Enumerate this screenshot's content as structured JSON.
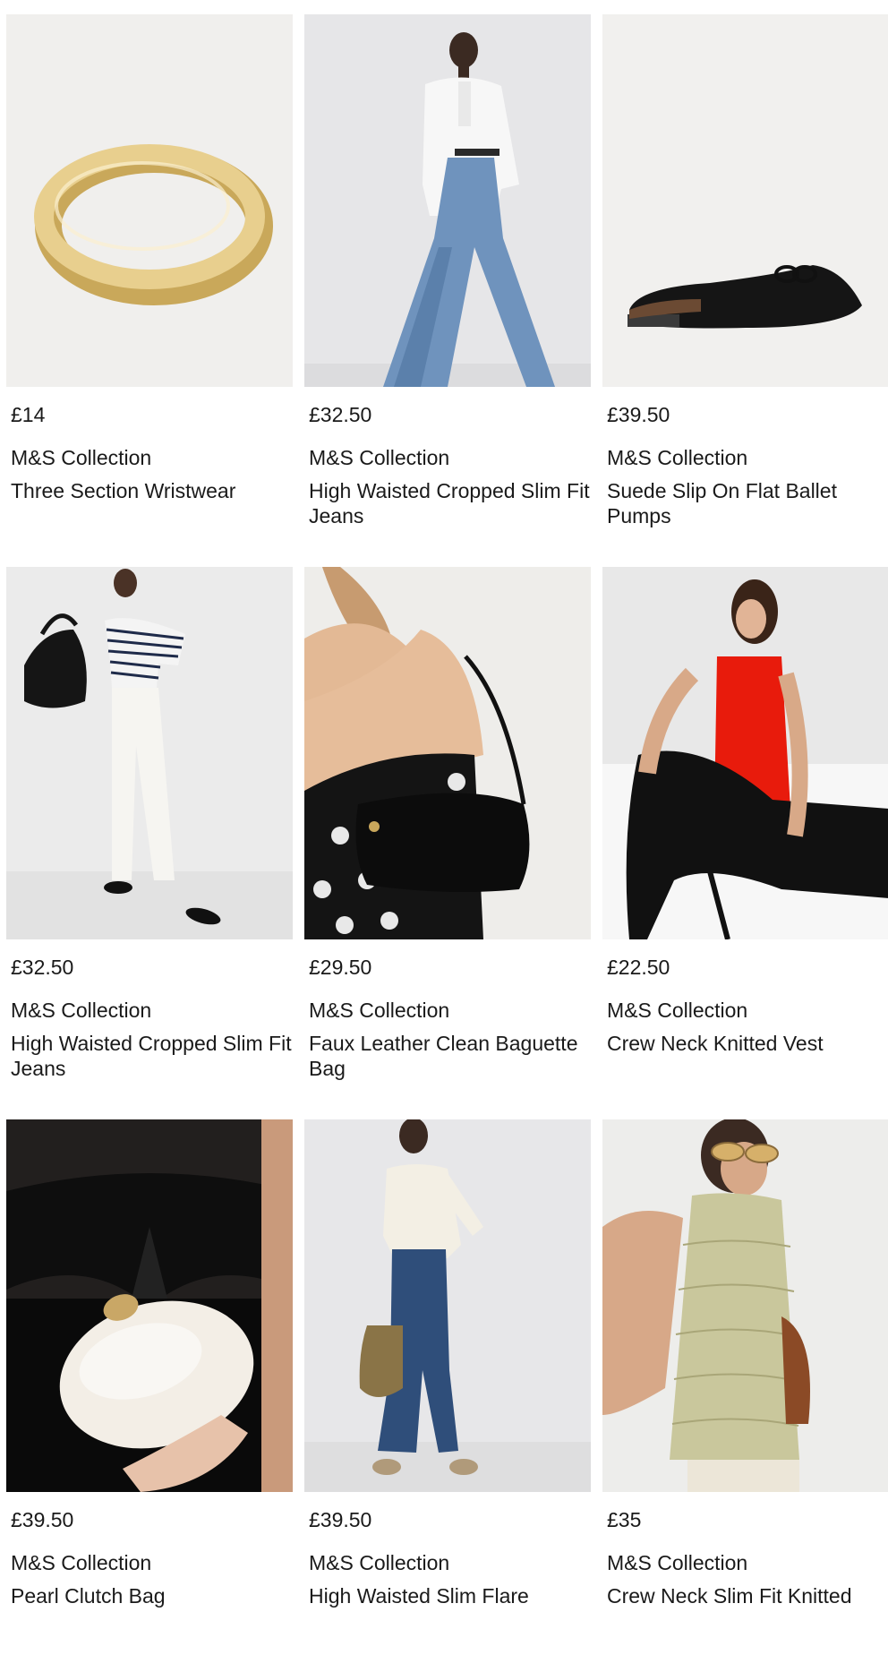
{
  "products": [
    {
      "price": "£14",
      "brand": "M&S Collection",
      "title": "Three Section Wristwear",
      "image": "gold-bangle-image"
    },
    {
      "price": "£32.50",
      "brand": "M&S Collection",
      "title": "High Waisted Cropped Slim Fit Jeans",
      "image": "model-white-shirt-jeans-image"
    },
    {
      "price": "£39.50",
      "brand": "M&S Collection",
      "title": "Suede Slip On Flat Ballet Pumps",
      "image": "black-mule-shoe-image"
    },
    {
      "price": "£32.50",
      "brand": "M&S Collection",
      "title": "High Waisted Cropped Slim Fit Jeans",
      "image": "model-white-jeans-striped-tee-image"
    },
    {
      "price": "£29.50",
      "brand": "M&S Collection",
      "title": "Faux Leather Clean Baguette Bag",
      "image": "black-baguette-bag-image"
    },
    {
      "price": "£22.50",
      "brand": "M&S Collection",
      "title": "Crew Neck Knitted Vest",
      "image": "model-red-vest-image"
    },
    {
      "price": "£39.50",
      "brand": "M&S Collection",
      "title": "Pearl Clutch Bag",
      "image": "pearl-clutch-bag-image"
    },
    {
      "price": "£39.50",
      "brand": "M&S Collection",
      "title": "High Waisted Slim Flare",
      "image": "model-flare-jeans-image"
    },
    {
      "price": "£35",
      "brand": "M&S Collection",
      "title": "Crew Neck Slim Fit Knitted",
      "image": "model-knitted-vest-image"
    }
  ]
}
